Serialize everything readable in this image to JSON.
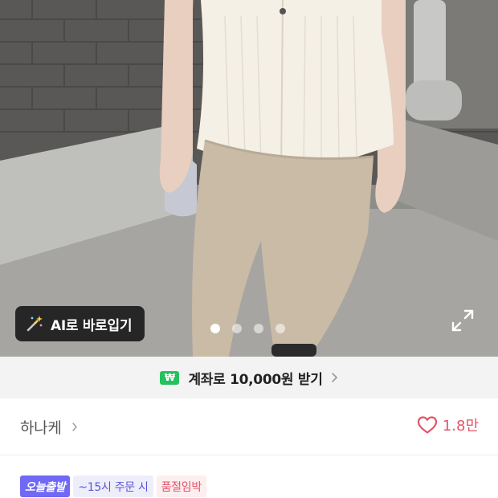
{
  "product_image": {
    "alt_icon": "product-photo",
    "ai_try_on": {
      "icon": "magic-wand-icon",
      "label": "AI로 바로입기"
    },
    "carousel": {
      "count": 4,
      "active_index": 0
    },
    "fullscreen_icon": "expand-icon"
  },
  "promo": {
    "icon_text": "₩",
    "text": "계좌로 10,000원 받기"
  },
  "shop": {
    "name": "하나케",
    "likes": "1.8만"
  },
  "badges": {
    "today": "오늘출발",
    "cutoff": "~15시 주문 시",
    "stock": "품절임박"
  },
  "colors": {
    "accent_purple": "#6f69f5",
    "like_red": "#e25467",
    "promo_green": "#23c25d"
  }
}
